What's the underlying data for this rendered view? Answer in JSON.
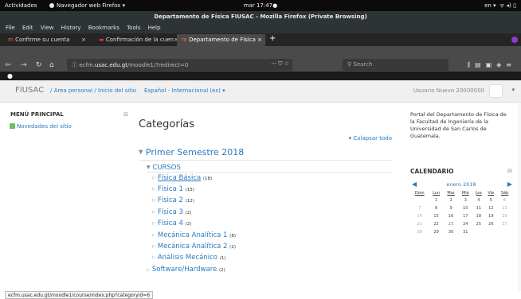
{
  "system": {
    "activities": "Actividades",
    "browser_menu": "Navegador web Firefox ▾",
    "clock": "mar 17:47●",
    "lang": "en ▾",
    "tray_icons": [
      "network-icon",
      "volume-icon",
      "battery-icon"
    ]
  },
  "window": {
    "title": "Departamento de Física FIUSAC - Mozilla Firefox (Private Browsing)"
  },
  "menu": [
    "File",
    "Edit",
    "View",
    "History",
    "Bookmarks",
    "Tools",
    "Help"
  ],
  "tabs": [
    {
      "label": "Confirme su cuenta",
      "close": "×"
    },
    {
      "label": "Confirmación de la cuen",
      "close": "×"
    },
    {
      "label": "Departamento de Física",
      "close": "×"
    }
  ],
  "nav": {
    "url_prefix": "ecfm.",
    "url_host": "usac.edu.gt",
    "url_path": "/moodle1/?redirect=0",
    "url_actions": "··· ⛉ ☆",
    "search_placeholder": "Search"
  },
  "moodle": {
    "brand": "FIUSAC",
    "breadcrumb": "/ Área personal / Inicio del sitio",
    "language": "Español - Internacional (es) ▾",
    "user": "Usuario Nuevo 20000000"
  },
  "left": {
    "title": "MENÚ PRINCIPAL",
    "link": "Novedades del sitio"
  },
  "main": {
    "title": "Categorías",
    "collapse_all": "▾ Colapsar todo",
    "semester": "Primer Semestre 2018",
    "cursos": "CURSOS",
    "courses": [
      {
        "name": "Física Básica",
        "count": "(18)"
      },
      {
        "name": "Física 1",
        "count": "(15)"
      },
      {
        "name": "Física 2",
        "count": "(12)"
      },
      {
        "name": "Física 3",
        "count": "(2)"
      },
      {
        "name": "Física 4",
        "count": "(2)"
      },
      {
        "name": "Mecánica Analítica 1",
        "count": "(8)"
      },
      {
        "name": "Mecánica Analítica 2",
        "count": "(2)"
      },
      {
        "name": "Análisis Mecánico",
        "count": "(1)"
      }
    ],
    "software": {
      "name": "Software/Hardware",
      "count": "(2)"
    }
  },
  "right": {
    "portal": "Portal del Departamento de Física de la Facultad de Ingeniería de la Universidad de San Carlos de Guatemala.",
    "calendar_title": "CALENDARIO",
    "month": "enero 2018",
    "days": [
      "Dom",
      "Lun",
      "Mar",
      "Mié",
      "Jue",
      "Vie",
      "Sáb"
    ],
    "weeks": [
      [
        "",
        "1",
        "2",
        "3",
        "4",
        "5",
        "6"
      ],
      [
        "7",
        "8",
        "9",
        "10",
        "11",
        "12",
        "13"
      ],
      [
        "14",
        "15",
        "16",
        "17",
        "18",
        "19",
        "20"
      ],
      [
        "21",
        "22",
        "23",
        "24",
        "25",
        "26",
        "27"
      ],
      [
        "28",
        "29",
        "30",
        "31",
        "",
        "",
        ""
      ]
    ]
  },
  "status": "ecfm.usac.edu.gt/moodle1/course/index.php?categoryid=6"
}
